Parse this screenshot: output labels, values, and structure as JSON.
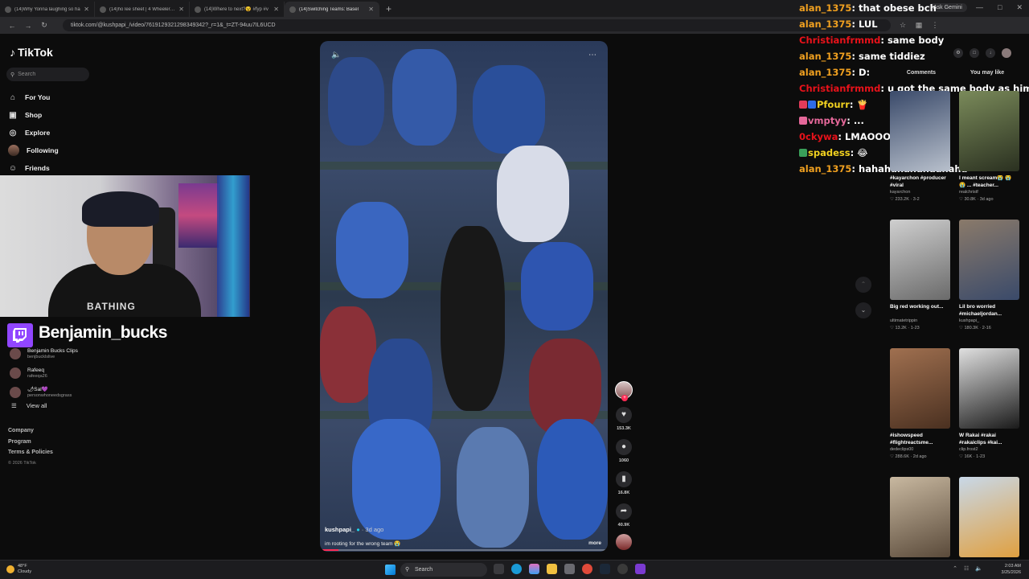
{
  "browser": {
    "tabs": [
      {
        "title": "(14)Why Yonna laughing so ha",
        "active": false
      },
      {
        "title": "(14)ho lee sheet | 4 Wheeler | T",
        "active": false
      },
      {
        "title": "(14)Where to next?😵 #fyp #v",
        "active": false
      },
      {
        "title": "(14)Switching Teams: Basel",
        "active": true
      }
    ],
    "ask_gemini": "Ask Gemini",
    "url": "tiktok.com/@kushpapi_/video/7619129321298349342?_r=1&_t=ZT-94uu7IL6UCD"
  },
  "tiktok": {
    "logo": "TikTok",
    "search_placeholder": "Search",
    "nav": [
      {
        "label": "For You",
        "icon": "home-icon",
        "glyph": "⌂"
      },
      {
        "label": "Shop",
        "icon": "shop-icon",
        "glyph": "▣"
      },
      {
        "label": "Explore",
        "icon": "compass-icon",
        "glyph": "◎"
      },
      {
        "label": "Following",
        "icon": "avatar",
        "glyph": ""
      },
      {
        "label": "Friends",
        "icon": "friends-icon",
        "glyph": "☺"
      }
    ],
    "following_accounts": [
      {
        "name": "Benjamin Bucks Clips",
        "handle": "benjbucklslive"
      },
      {
        "name": "Rafeeq",
        "handle": "rafeeqa26"
      },
      {
        "name": "🌶Sal💜",
        "handle": "personwhoneedsgrass"
      }
    ],
    "view_all": "View all",
    "footer": [
      "Company",
      "Program",
      "Terms & Policies"
    ],
    "copyright": "© 2026 TikTok"
  },
  "stream": {
    "streamer_name": "Benjamin_bucks",
    "webcam_shirt_text": "BATHING",
    "brand_color": "#9146ff"
  },
  "video": {
    "username": "kushpapi_",
    "date": "3d ago",
    "caption": "im rooting for the wrong team 😭",
    "more": "more",
    "progress_fraction": 0.06,
    "likes": "153.3K",
    "comments": "1060",
    "saves": "16.8K",
    "shares": "40.9K"
  },
  "chat": [
    {
      "user": "alan_1375",
      "color": "#f0a020",
      "text": "that obese bch",
      "badges": []
    },
    {
      "user": "alan_1375",
      "color": "#f0a020",
      "text": "LUL",
      "badges": []
    },
    {
      "user": "Christianfrmmd",
      "color": "#e8121a",
      "text": "same body",
      "badges": []
    },
    {
      "user": "alan_1375",
      "color": "#f0a020",
      "text": "same tiddiez",
      "badges": []
    },
    {
      "user": "alan_1375",
      "color": "#f0a020",
      "text": "D:",
      "badges": []
    },
    {
      "user": "Christianfrmmd",
      "color": "#e8121a",
      "text": "u got the same body as him",
      "badges": []
    },
    {
      "user": "Pfourr",
      "color": "#f0d020",
      "text": "🍟",
      "badges": [
        "#e23b5a",
        "#2e6be6"
      ]
    },
    {
      "user": "vmptyy",
      "color": "#e5689a",
      "text": "...",
      "badges": [
        "#e5689a"
      ]
    },
    {
      "user": "0ckywa",
      "color": "#e8121a",
      "text": "LMAOOOOOOOOO",
      "badges": []
    },
    {
      "user": "spadess",
      "color": "#f0d020",
      "text": "😂",
      "badges": [
        "#3aa05a"
      ]
    },
    {
      "user": "alan_1375",
      "color": "#f0a020",
      "text": "hahahahahahaahaha",
      "badges": []
    }
  ],
  "right_panel": {
    "tabs": [
      "Comments",
      "You may like"
    ],
    "cards": [
      {
        "title": "#kayarchon #producer #viral",
        "user": "kayarchon",
        "meta": "♡ 233.2K · 3-2",
        "c1": "#3a4a6a",
        "c2": "#b8c0cc"
      },
      {
        "title": "I meant scream😭 😭 😭 ... #teacher...",
        "user": "realchristf",
        "meta": "♡ 30.8K · 3d ago",
        "c1": "#7a8a5a",
        "c2": "#2a3020"
      },
      {
        "title": "Big red working out...",
        "user": "ultimatetrippin",
        "meta": "♡ 13.2K · 1-23",
        "c1": "#cfcfcf",
        "c2": "#6a6a6a"
      },
      {
        "title": "Lil bro worried #michaeljordan...",
        "user": "kushpapi_",
        "meta": "♡ 180.3K · 2-16",
        "c1": "#8a7a6a",
        "c2": "#3a4a6a"
      },
      {
        "title": "#ishowspeed #flightreactsme...",
        "user": "dedeclips00",
        "meta": "♡ 288.6K · 2d ago",
        "c1": "#a07050",
        "c2": "#4a3020"
      },
      {
        "title": "W Rakai #rakai #rakaiclips #kai...",
        "user": "clip.frost2",
        "meta": "♡ 16K · 1-23",
        "c1": "#e0e0e0",
        "c2": "#1a1a1a"
      },
      {
        "title": "",
        "user": "",
        "meta": "",
        "c1": "#c8b8a0",
        "c2": "#5a4a3a"
      },
      {
        "title": "",
        "user": "",
        "meta": "",
        "c1": "#c8d8e8",
        "c2": "#e0a040"
      }
    ]
  },
  "taskbar": {
    "weather_temp": "48°F",
    "weather_cond": "Cloudy",
    "search_label": "Search",
    "time": "2:03 AM",
    "date": "3/25/2026"
  }
}
